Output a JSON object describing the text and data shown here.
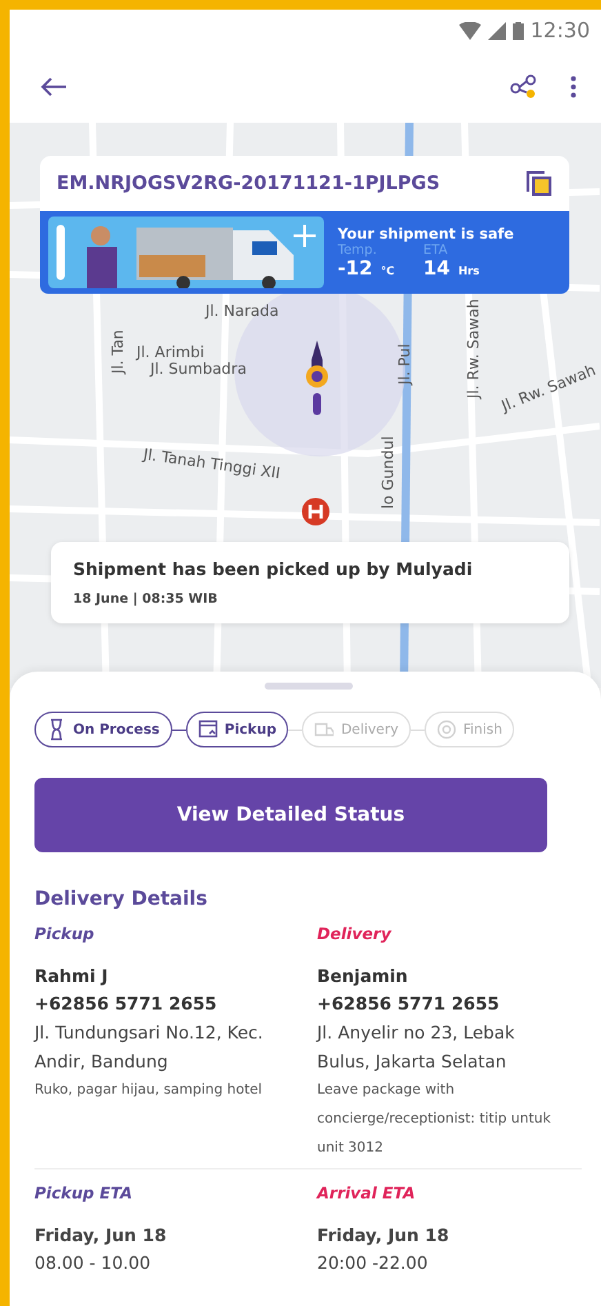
{
  "status_bar": {
    "time": "12:30"
  },
  "map": {
    "street_labels": [
      "Jl. Narada",
      "Jl. Arimbi",
      "Jl. Sumbadra",
      "Jl. Tanah Tinggi XII",
      "Jl. Rw. Sawah",
      "Jl. Rw. Sawah",
      "Jl. Pul",
      "Jl. Tan",
      "lo Gundul"
    ]
  },
  "shipment": {
    "tracking_code": "EM.NRJOGSV2RG-20171121-1PJLPGS",
    "banner_title": "Your shipment is safe",
    "temp_label": "Temp.",
    "temp_value": "-12",
    "temp_unit": "°C",
    "eta_label": "ETA",
    "eta_value": "14",
    "eta_unit": "Hrs"
  },
  "update": {
    "message": "Shipment has been picked up by Mulyadi",
    "time": "18 June | 08:35 WIB"
  },
  "steps": [
    {
      "label": "On Process",
      "active": true,
      "kind": "hourglass"
    },
    {
      "label": "Pickup",
      "active": true,
      "kind": "box"
    },
    {
      "label": "Delivery",
      "active": false,
      "kind": "truck"
    },
    {
      "label": "Finish",
      "active": false,
      "kind": "target"
    }
  ],
  "primary_button": "View Detailed Status",
  "details": {
    "title": "Delivery Details",
    "parties": [
      {
        "heading": "Pickup",
        "kind": "pickup",
        "name": "Rahmi J",
        "phone": "+62856 5771 2655",
        "address": "Jl. Tundungsari No.12, Kec. Andir, Bandung",
        "note": "Ruko, pagar hijau, samping hotel"
      },
      {
        "heading": "Delivery",
        "kind": "delivery",
        "name": "Benjamin",
        "phone": "+62856 5771 2655",
        "address": "Jl. Anyelir no 23, Lebak Bulus, Jakarta Selatan",
        "note": "Leave package with concierge/receptionist: titip untuk unit 3012"
      }
    ],
    "etas": [
      {
        "heading": "Pickup ETA",
        "kind": "pickup",
        "date": "Friday, Jun 18",
        "time": "08.00 - 10.00"
      },
      {
        "heading": "Arrival ETA",
        "kind": "delivery",
        "date": "Friday, Jun 18",
        "time": "20:00 -22.00"
      }
    ]
  }
}
